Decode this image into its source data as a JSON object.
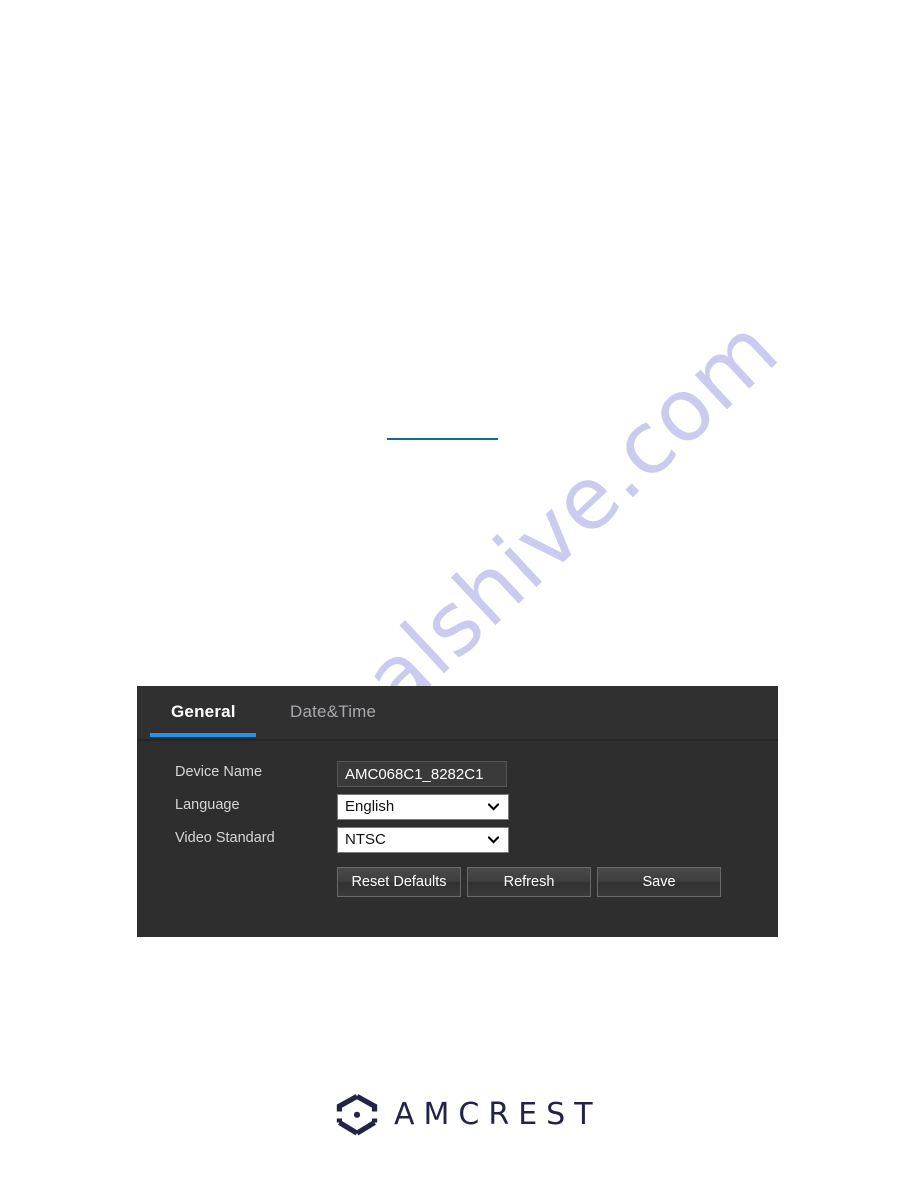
{
  "watermark": {
    "text": "manualshive.com",
    "color": "#c9c9f0"
  },
  "link_rule": {
    "color": "#12699b"
  },
  "panel": {
    "background": "#2e2e2e",
    "accent_color": "#2196e8",
    "tabs": [
      {
        "label": "General",
        "active": true
      },
      {
        "label": "Date&Time",
        "active": false
      }
    ],
    "fields": [
      {
        "label": "Device Name",
        "type": "text",
        "value": "AMC068C1_8282C1",
        "placeholder": "Device Name"
      },
      {
        "label": "Language",
        "type": "select",
        "value": "English"
      },
      {
        "label": "Video Standard",
        "type": "select",
        "value": "NTSC"
      }
    ],
    "buttons": [
      {
        "label": "Reset Defaults"
      },
      {
        "label": "Refresh"
      },
      {
        "label": "Save"
      }
    ]
  },
  "footer": {
    "brand": "AMCREST",
    "brand_color": "#232347",
    "mark_accent": "#2d6fd0"
  }
}
